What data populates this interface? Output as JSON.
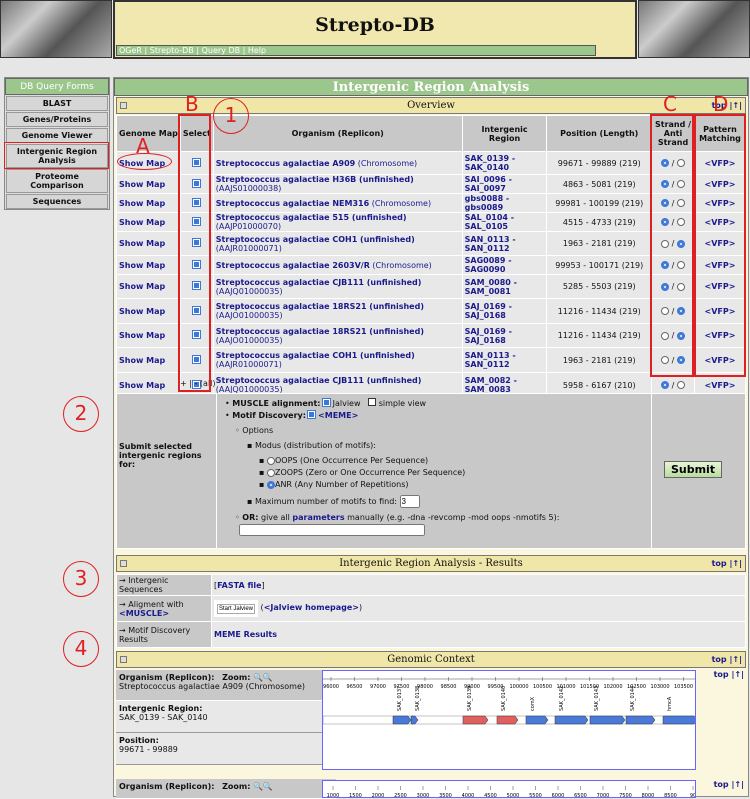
{
  "header": {
    "title": "Strepto-DB",
    "nav": "OGeR | Strepto-DB | Query DB | Help"
  },
  "sidebar": {
    "title": "DB Query Forms",
    "items": [
      "BLAST",
      "Genes/Proteins",
      "Genome Viewer",
      "Intergenic Region Analysis",
      "Proteome Comparison",
      "Sequences"
    ],
    "active": 3
  },
  "main": {
    "title": "Intergenic Region Analysis"
  },
  "overview": {
    "title": "Overview",
    "top": "top |↑|",
    "columns": [
      "Genome Map",
      "Select",
      "Organism (Replicon)",
      "Intergenic Region",
      "Position (Length)",
      "Strand / Anti Strand",
      "Pattern Matching"
    ],
    "rows": [
      {
        "map": "Show Map",
        "org": "Streptococcus agalactiae A909",
        "rep": "(Chromosome)",
        "region": "SAK_0139 - SAK_0140",
        "pos": "99671 - 99889 (219)",
        "strand": "plus",
        "vfp": "<VFP>"
      },
      {
        "map": "Show Map",
        "org": "Streptococcus agalactiae H36B (unfinished)",
        "rep": "(AAJS01000038)",
        "region": "SAI_0096 - SAI_0097",
        "pos": "4863 - 5081 (219)",
        "strand": "plus",
        "vfp": "<VFP>"
      },
      {
        "map": "Show Map",
        "org": "Streptococcus agalactiae NEM316",
        "rep": "(Chromosome)",
        "region": "gbs0088 - gbs0089",
        "pos": "99981 - 100199 (219)",
        "strand": "plus",
        "vfp": "<VFP>"
      },
      {
        "map": "Show Map",
        "org": "Streptococcus agalactiae 515 (unfinished)",
        "rep": "(AAJP01000070)",
        "region": "SAL_0104 - SAL_0105",
        "pos": "4515 - 4733 (219)",
        "strand": "plus",
        "vfp": "<VFP>"
      },
      {
        "map": "Show Map",
        "org": "Streptococcus agalactiae COH1 (unfinished)",
        "rep": "(AAJR01000071)",
        "region": "SAN_0113 - SAN_0112",
        "pos": "1963 - 2181 (219)",
        "strand": "minus",
        "vfp": "<VFP>"
      },
      {
        "map": "Show Map",
        "org": "Streptococcus agalactiae 2603V/R",
        "rep": "(Chromosome)",
        "region": "SAG0089 - SAG0090",
        "pos": "99953 - 100171 (219)",
        "strand": "plus",
        "vfp": "<VFP>"
      },
      {
        "map": "Show Map",
        "org": "Streptococcus agalactiae CJB111 (unfinished)",
        "rep": "(AAJQ01000035)",
        "region": "SAM_0080 - SAM_0081",
        "pos": "5285 - 5503 (219)",
        "strand": "plus",
        "vfp": "<VFP>"
      },
      {
        "map": "Show Map",
        "org": "Streptococcus agalactiae 18RS21 (unfinished)",
        "rep": "(AAJO01000035)",
        "region": "SAJ_0169 - SAJ_0168",
        "pos": "11216 - 11434 (219)",
        "strand": "minus",
        "vfp": "<VFP>"
      },
      {
        "map": "Show Map",
        "org": "Streptococcus agalactiae 18RS21 (unfinished)",
        "rep": "(AAJO01000035)",
        "region": "SAJ_0169 - SAJ_0168",
        "pos": "11216 - 11434 (219)",
        "strand": "minus",
        "vfp": "<VFP>"
      },
      {
        "map": "Show Map",
        "org": "Streptococcus agalactiae COH1 (unfinished)",
        "rep": "(AAJR01000071)",
        "region": "SAN_0113 - SAN_0112",
        "pos": "1963 - 2181 (219)",
        "strand": "minus",
        "vfp": "<VFP>"
      },
      {
        "map": "Show Map",
        "org": "Streptococcus agalactiae CJB111 (unfinished)",
        "rep": "(AAJQ01000035)",
        "region": "SAM_0082 - SAM_0083",
        "pos": "5958 - 6167 (210)",
        "strand": "plus",
        "vfp": "<VFP>"
      }
    ],
    "select_all": "+ | - (all)"
  },
  "form": {
    "label": "Submit selected intergenic regions for:",
    "muscle": "MUSCLE alignment:",
    "jalview": "Jalview",
    "simple": "simple view",
    "motif": "Motif Discovery:",
    "meme": "<MEME>",
    "options": "Options",
    "modus": "Modus (distribution of motifs):",
    "oops": "OOPS (One Occurrence Per Sequence)",
    "zoops": "ZOOPS (Zero or One Occurrence Per Sequence)",
    "anr": "ANR (Any Number of Repetitions)",
    "maxlabel": "Maximum number of motifs to find:",
    "maxval": "3",
    "or": "OR:",
    "or_text1": "give all",
    "params": "parameters",
    "or_text2": "manually (e.g. -dna -revcomp -mod oops -nmotifs 5):",
    "manual": "",
    "submit": "Submit"
  },
  "results": {
    "title": "Intergenic Region Analysis - Results",
    "top": "top |↑|",
    "seq_label": "→ Intergenic Sequences",
    "fasta": "FASTA file",
    "align_label": "→ Aligment with",
    "muscle": "<MUSCLE>",
    "start_jalview": "Start Jalview",
    "jal_home": "<Jalview homepage>",
    "motif_label": "→ Motif Discovery Results",
    "meme_results": "MEME Results"
  },
  "genomic": {
    "title": "Genomic Context",
    "top": "top |↑|",
    "org_label": "Organism (Replicon):",
    "zoom": "Zoom:",
    "org": "Streptococcus agalactiae A909 (Chromosome)",
    "ir_label": "Intergenic Region:",
    "ir": "SAK_0139 - SAK_0140",
    "pos_label": "Position:",
    "pos": "99671 - 99889",
    "ticks": [
      "96000",
      "96500",
      "97000",
      "97500",
      "98000",
      "98500",
      "99000",
      "99500",
      "100000",
      "100500",
      "101000",
      "101500",
      "102000",
      "102500",
      "103000",
      "103500"
    ],
    "ticks2": [
      "1000",
      "1500",
      "2000",
      "2500",
      "3000",
      "3500",
      "4000",
      "4500",
      "5000",
      "5500",
      "6000",
      "6500",
      "7000",
      "7500",
      "8000",
      "8500",
      "90"
    ],
    "genes": [
      "SAK_0137",
      "SAK_0138",
      "SAK_0139",
      "SAK_0140",
      "comX",
      "SAK_0142",
      "SAK_0143",
      "SAK_0144",
      "hmcA"
    ]
  },
  "annotations": {
    "A": "A",
    "B": "B",
    "C": "C",
    "D": "D",
    "n1": "1",
    "n2": "2",
    "n3": "3",
    "n4": "4"
  },
  "colors": {
    "green": "#9cc78c",
    "khaki": "#f0e6a8",
    "link": "#1a1a8c",
    "annotation": "#e02020",
    "gene_plus": "#4a7ad8",
    "gene_target": "#e06060"
  }
}
